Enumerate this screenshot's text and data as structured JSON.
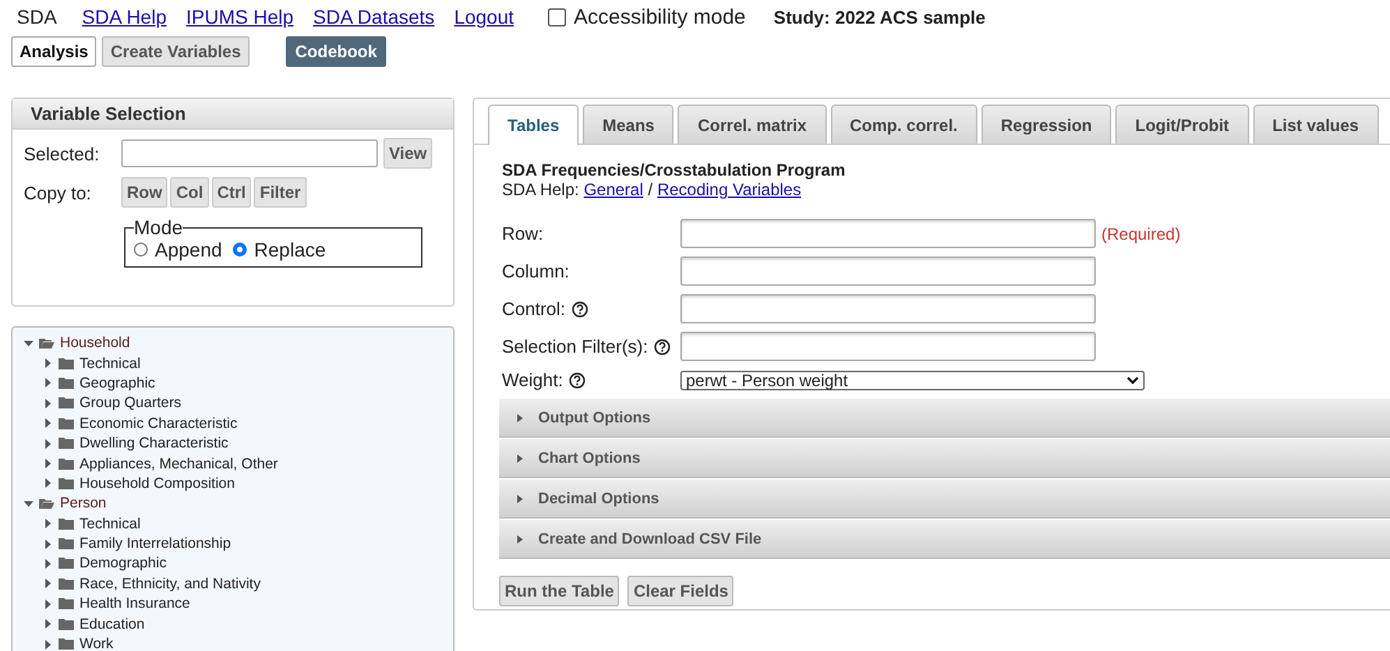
{
  "header": {
    "brand": "SDA",
    "links": [
      "SDA Help",
      "IPUMS Help",
      "SDA Datasets",
      "Logout"
    ],
    "accessibility": {
      "label": "Accessibility mode",
      "checked": false
    },
    "study": "Study: 2022 ACS sample"
  },
  "analysis_tabs": [
    {
      "label": "Analysis",
      "selected": true
    },
    {
      "label": "Create Variables",
      "selected": false
    }
  ],
  "codebook_button": "Codebook",
  "variable_selection": {
    "title": "Variable Selection",
    "selected_label": "Selected:",
    "view_button": "View",
    "copy_label": "Copy to:",
    "copy_buttons": [
      "Row",
      "Col",
      "Ctrl",
      "Filter"
    ],
    "mode": {
      "legend": "Mode",
      "options": [
        {
          "label": "Append",
          "selected": false
        },
        {
          "label": "Replace",
          "selected": true
        }
      ]
    }
  },
  "tree": [
    {
      "label": "Household",
      "expanded": true,
      "children": [
        {
          "label": "Technical",
          "expanded": false
        },
        {
          "label": "Geographic",
          "expanded": false
        },
        {
          "label": "Group Quarters",
          "expanded": false
        },
        {
          "label": "Economic Characteristic",
          "expanded": false
        },
        {
          "label": "Dwelling Characteristic",
          "expanded": false
        },
        {
          "label": "Appliances, Mechanical, Other",
          "expanded": false
        },
        {
          "label": "Household Composition",
          "expanded": false
        }
      ]
    },
    {
      "label": "Person",
      "expanded": true,
      "children": [
        {
          "label": "Technical",
          "expanded": false
        },
        {
          "label": "Family Interrelationship",
          "expanded": false
        },
        {
          "label": "Demographic",
          "expanded": false
        },
        {
          "label": "Race, Ethnicity, and Nativity",
          "expanded": false
        },
        {
          "label": "Health Insurance",
          "expanded": false
        },
        {
          "label": "Education",
          "expanded": false
        },
        {
          "label": "Work",
          "expanded": false
        }
      ]
    }
  ],
  "main": {
    "tabs": [
      {
        "label": "Tables",
        "selected": true
      },
      {
        "label": "Means",
        "selected": false
      },
      {
        "label": "Correl. matrix",
        "selected": false
      },
      {
        "label": "Comp. correl.",
        "selected": false
      },
      {
        "label": "Regression",
        "selected": false
      },
      {
        "label": "Logit/Probit",
        "selected": false
      },
      {
        "label": "List values",
        "selected": false
      }
    ],
    "program_title": "SDA Frequencies/Crosstabulation Program",
    "help_label": "SDA Help:",
    "help_links": [
      "General",
      "Recoding Variables"
    ],
    "help_separator": "/",
    "fields": [
      {
        "label": "Row:",
        "kind": "text",
        "help": false,
        "note": "(Required)"
      },
      {
        "label": "Column:",
        "kind": "text",
        "help": false
      },
      {
        "label": "Control:",
        "kind": "text",
        "help": true
      },
      {
        "label": "Selection Filter(s):",
        "kind": "text",
        "help": true
      },
      {
        "label": "Weight:",
        "kind": "select",
        "help": true,
        "value": "perwt - Person weight"
      }
    ],
    "sections": [
      {
        "label": "Output Options",
        "expanded": false
      },
      {
        "label": "Chart Options",
        "expanded": false
      },
      {
        "label": "Decimal Options",
        "expanded": false
      },
      {
        "label": "Create and Download CSV File",
        "expanded": false
      }
    ],
    "buttons": [
      "Run the Table",
      "Clear Fields"
    ]
  }
}
